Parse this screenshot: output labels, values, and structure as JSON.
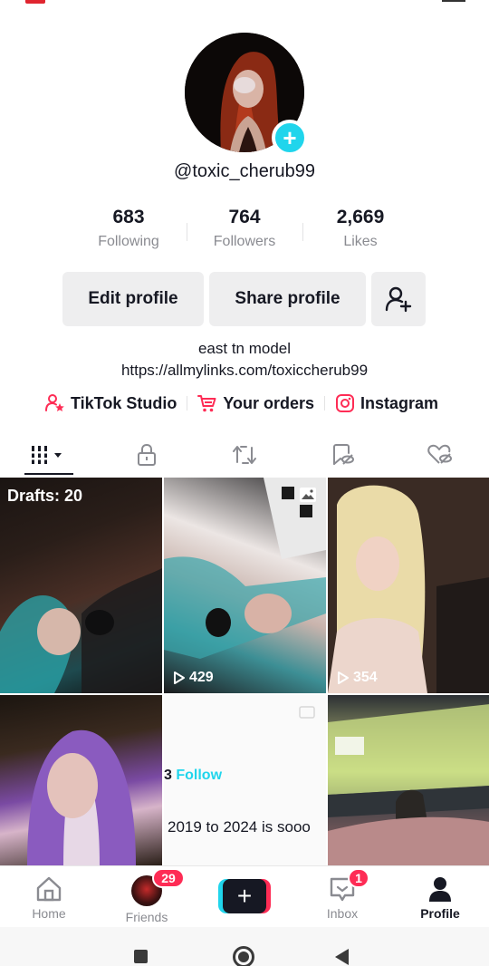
{
  "profile": {
    "username": "@toxic_cherub99",
    "add_icon": "plus-icon",
    "stats": [
      {
        "value": "683",
        "label": "Following"
      },
      {
        "value": "764",
        "label": "Followers"
      },
      {
        "value": "2,669",
        "label": "Likes"
      }
    ],
    "buttons": {
      "edit": "Edit profile",
      "share": "Share profile",
      "add_friends_icon": "add-friend-icon"
    },
    "bio_line1": "east tn model",
    "bio_line2": "https://allmylinks.com/toxiccherub99",
    "links": [
      {
        "label": "TikTok Studio",
        "icon": "studio-icon",
        "color": "#fe2c55"
      },
      {
        "label": "Your orders",
        "icon": "cart-icon",
        "color": "#fe2c55"
      },
      {
        "label": "Instagram",
        "icon": "instagram-icon",
        "color": "#fe2c55"
      }
    ]
  },
  "tabs": [
    {
      "icon": "grid-icon",
      "active": true
    },
    {
      "icon": "lock-icon"
    },
    {
      "icon": "repost-icon"
    },
    {
      "icon": "saved-icon"
    },
    {
      "icon": "liked-icon"
    }
  ],
  "videos": [
    {
      "overlay": "Drafts: 20"
    },
    {
      "views": "429",
      "icon": "photo-icon"
    },
    {
      "views": "354"
    },
    {},
    {
      "follow_pre": "3",
      "follow": "Follow",
      "caption": "2019 to 2024 is sooo"
    },
    {}
  ],
  "nav": {
    "home": "Home",
    "friends": "Friends",
    "friends_badge": "29",
    "create_symbol": "+",
    "inbox": "Inbox",
    "inbox_badge": "1",
    "profile": "Profile"
  },
  "colors": {
    "accent": "#fe2c55",
    "cyan": "#20d5ec",
    "text": "#161823",
    "muted": "#8a8b91"
  }
}
